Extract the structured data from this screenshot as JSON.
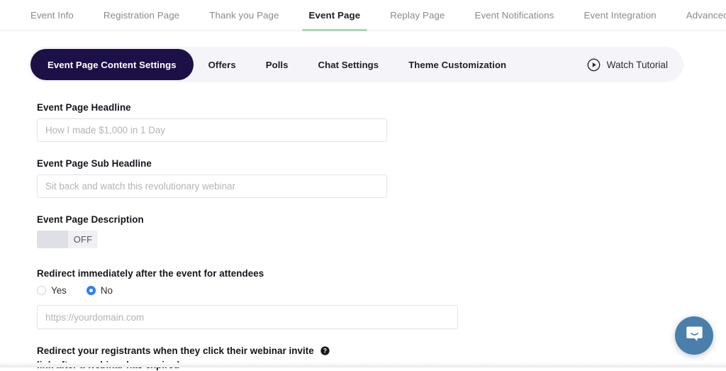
{
  "theme": {
    "accent_navy": "#1c1047",
    "tab_underline_green": "#a8d5b5",
    "radio_blue": "#2b7cff",
    "chat_blue": "#4a7fab",
    "pillbar_bg": "#f5f5f9"
  },
  "topnav": {
    "items": [
      {
        "label": "Event Info",
        "active": false
      },
      {
        "label": "Registration Page",
        "active": false
      },
      {
        "label": "Thank you Page",
        "active": false
      },
      {
        "label": "Event Page",
        "active": true
      },
      {
        "label": "Replay Page",
        "active": false
      },
      {
        "label": "Event Notifications",
        "active": false
      },
      {
        "label": "Event Integration",
        "active": false
      },
      {
        "label": "Advanced Options",
        "active": false
      }
    ]
  },
  "pillbar": {
    "tabs": [
      {
        "label": "Event Page Content Settings",
        "active": true
      },
      {
        "label": "Offers",
        "active": false
      },
      {
        "label": "Polls",
        "active": false
      },
      {
        "label": "Chat Settings",
        "active": false
      },
      {
        "label": "Theme Customization",
        "active": false
      }
    ],
    "watch_tutorial_label": "Watch Tutorial",
    "play_icon": "play-circle-icon"
  },
  "form": {
    "headline": {
      "label": "Event Page Headline",
      "value": "",
      "placeholder": "How I made $1,000 in 1 Day"
    },
    "sub_headline": {
      "label": "Event Page Sub Headline",
      "value": "",
      "placeholder": "Sit back and watch this revolutionary webinar"
    },
    "description": {
      "label": "Event Page Description",
      "toggle_state": "OFF"
    },
    "redirect": {
      "label": "Redirect immediately after the event for attendees",
      "options": [
        {
          "label": "Yes",
          "selected": false
        },
        {
          "label": "No",
          "selected": true
        }
      ],
      "url_value": "",
      "url_placeholder": "https://yourdomain.com"
    },
    "helper": {
      "line1": "Redirect your registrants when they click their webinar invite",
      "line2": "link after a webinar has expired",
      "help_icon": "question-mark-circle-icon"
    }
  },
  "chat_widget": {
    "icon": "chat-bubble-icon",
    "label": "Open chat"
  }
}
